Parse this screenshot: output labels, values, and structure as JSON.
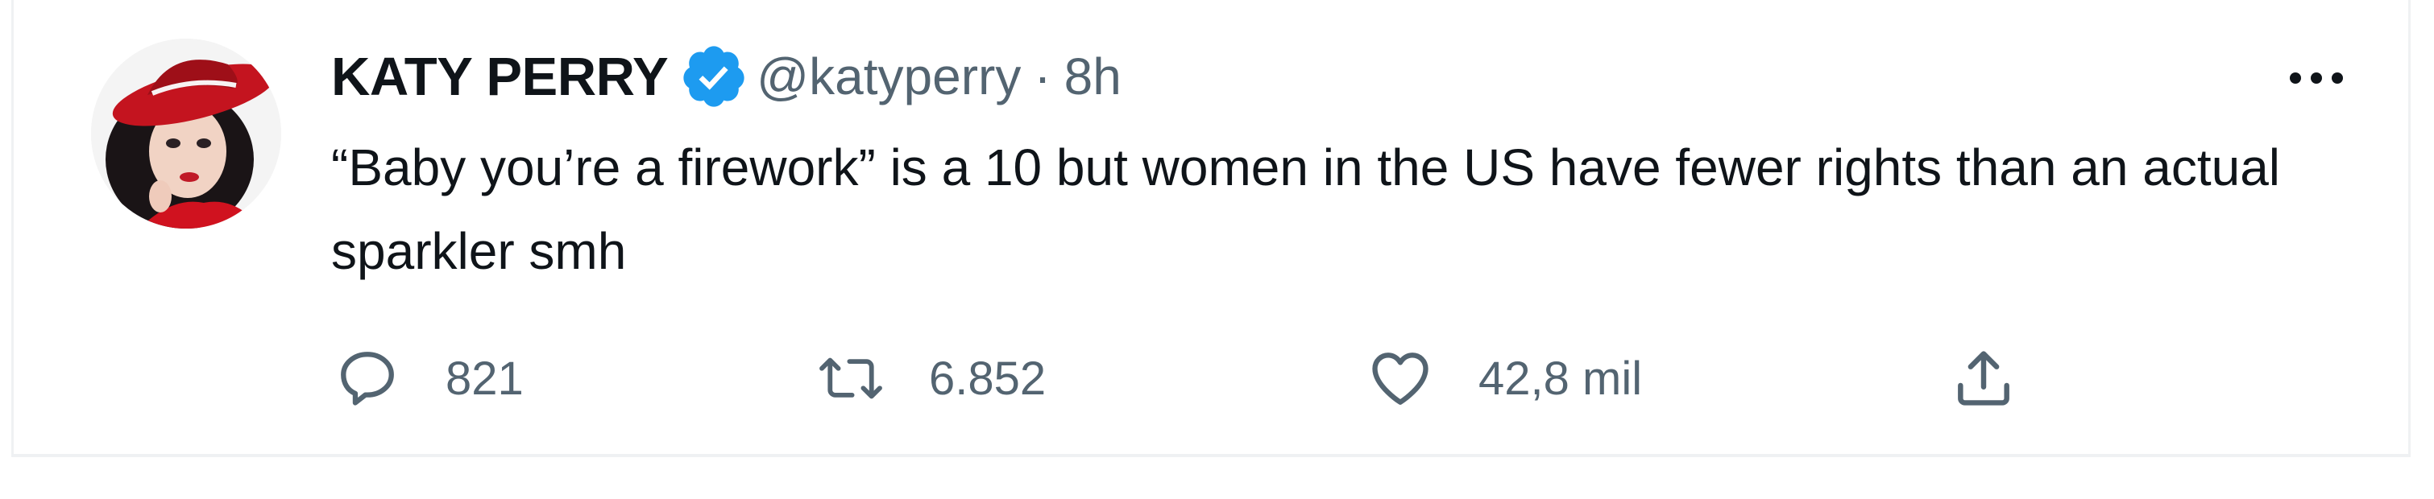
{
  "tweet": {
    "display_name": "KATY PERRY",
    "handle": "@katyperry",
    "separator": "·",
    "time": "8h",
    "text": "“Baby you’re a firework” is a 10 but women in the US have fewer rights than an actual sparkler smh",
    "verified_icon": "verified-badge-icon",
    "more_icon": "more-options-icon"
  },
  "actions": {
    "reply": {
      "icon": "reply-icon",
      "count": "821"
    },
    "retweet": {
      "icon": "retweet-icon",
      "count": "6.852"
    },
    "like": {
      "icon": "heart-icon",
      "count": "42,8 mil"
    },
    "share": {
      "icon": "share-icon"
    }
  },
  "colors": {
    "text_primary": "#0f1419",
    "text_secondary": "#536471",
    "verified_blue": "#1d9bf0",
    "border": "#eff1f3"
  }
}
